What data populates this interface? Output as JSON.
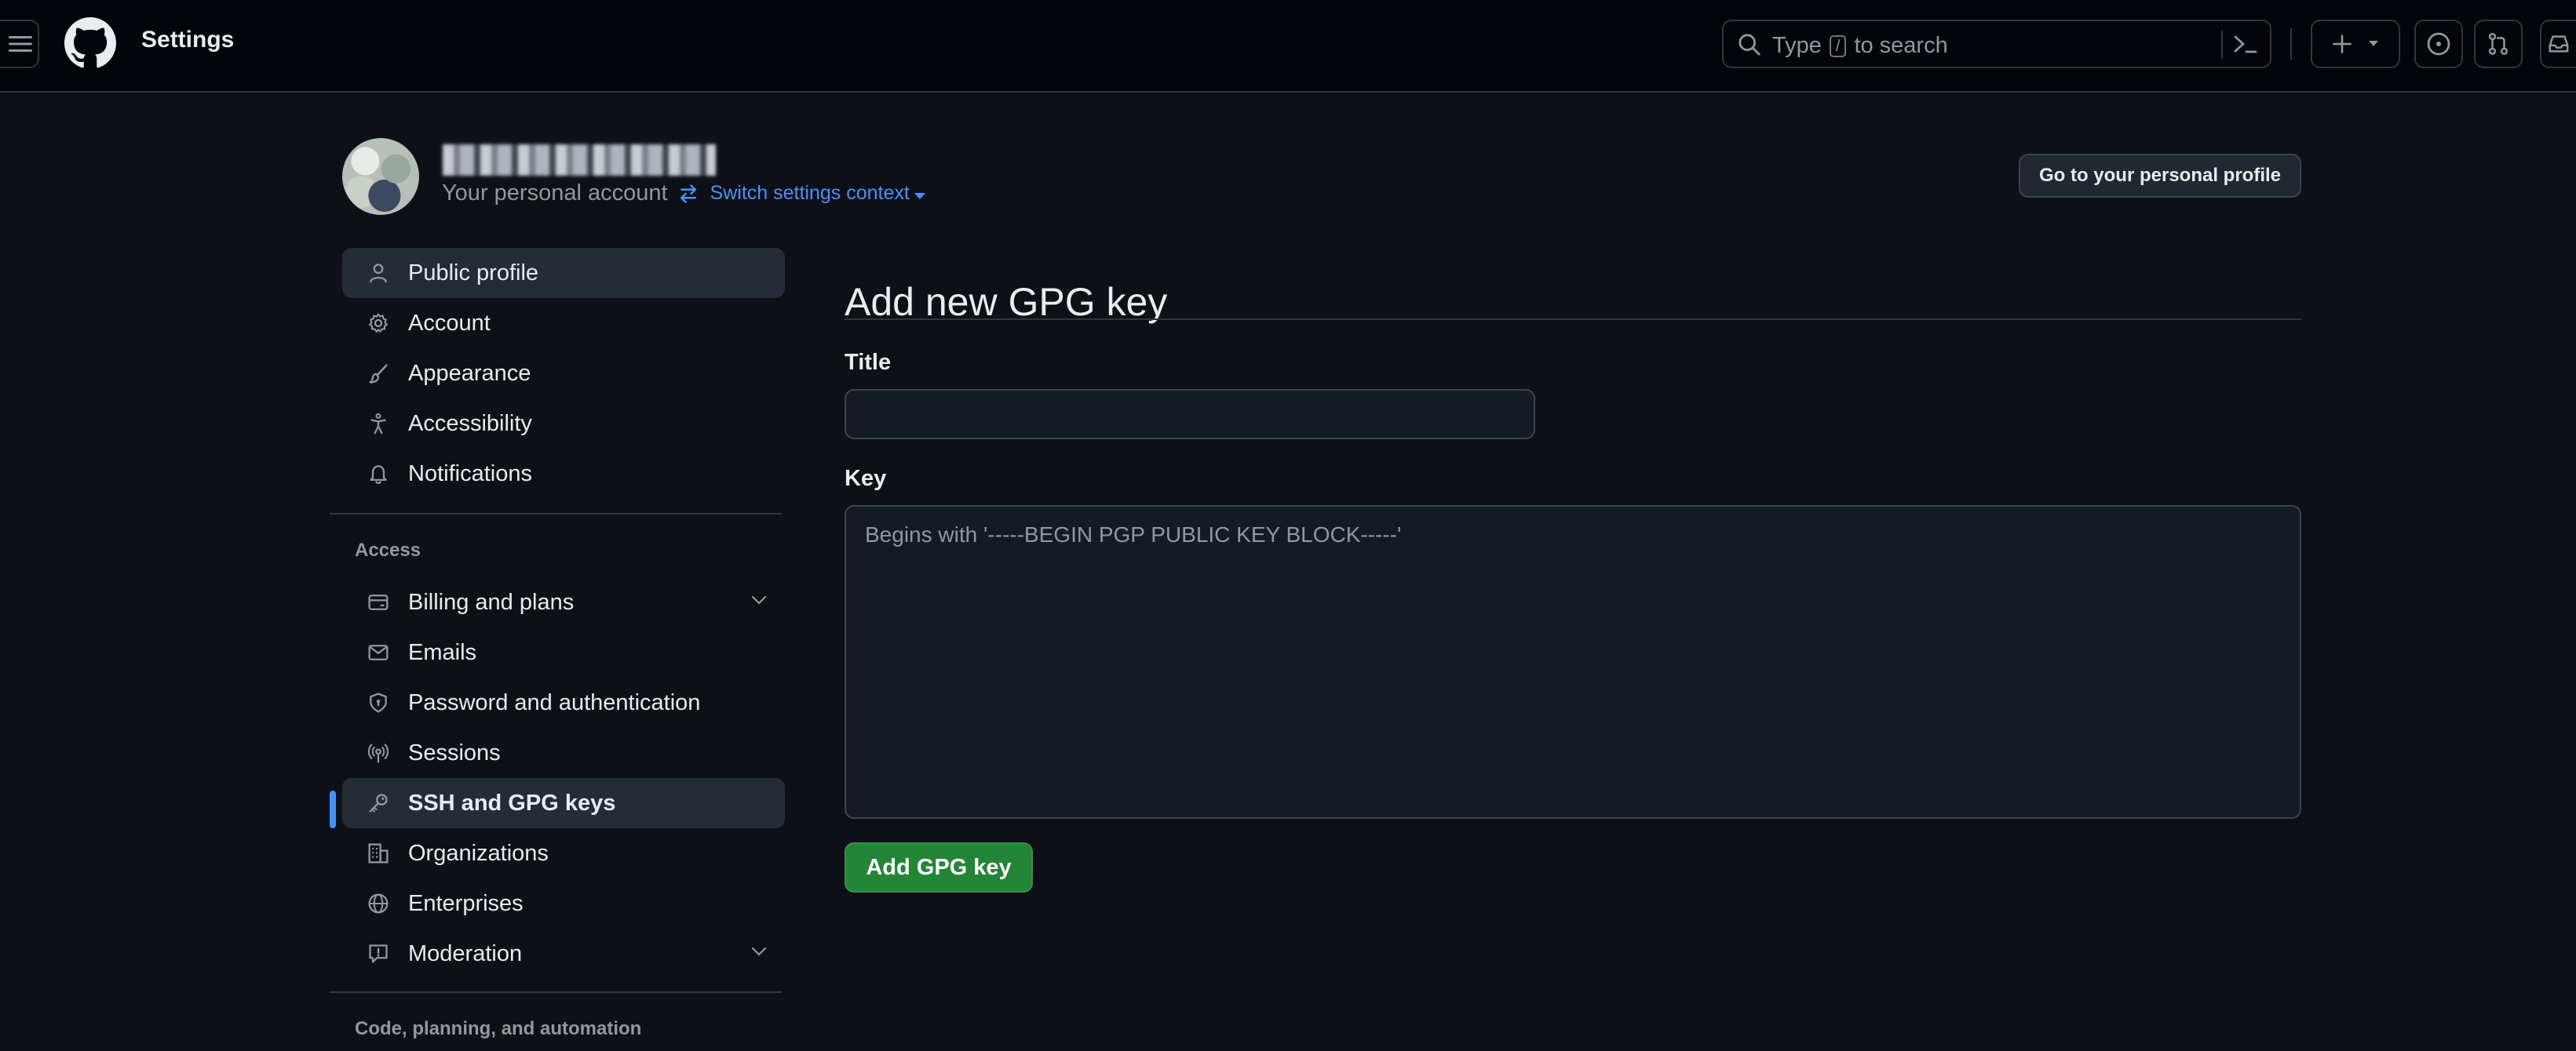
{
  "header": {
    "title": "Settings",
    "search": {
      "prefix": "Type",
      "key": "/",
      "suffix": "to search"
    }
  },
  "context": {
    "account_type": "Your personal account",
    "switch_label": "Switch settings context",
    "profile_button": "Go to your personal profile"
  },
  "sidebar": {
    "items": [
      {
        "label": "Public profile",
        "icon": "person-icon"
      },
      {
        "label": "Account",
        "icon": "gear-icon"
      },
      {
        "label": "Appearance",
        "icon": "paintbrush-icon"
      },
      {
        "label": "Accessibility",
        "icon": "accessibility-icon"
      },
      {
        "label": "Notifications",
        "icon": "bell-icon"
      }
    ],
    "access_heading": "Access",
    "access_items": [
      {
        "label": "Billing and plans",
        "icon": "credit-card-icon",
        "expandable": true
      },
      {
        "label": "Emails",
        "icon": "mail-icon"
      },
      {
        "label": "Password and authentication",
        "icon": "shield-lock-icon"
      },
      {
        "label": "Sessions",
        "icon": "broadcast-icon"
      },
      {
        "label": "SSH and GPG keys",
        "icon": "key-icon",
        "selected": true
      },
      {
        "label": "Organizations",
        "icon": "organization-icon"
      },
      {
        "label": "Enterprises",
        "icon": "globe-icon"
      },
      {
        "label": "Moderation",
        "icon": "report-icon",
        "expandable": true
      }
    ],
    "code_heading": "Code, planning, and automation"
  },
  "main": {
    "title": "Add new GPG key",
    "title_label": "Title",
    "title_value": "",
    "key_label": "Key",
    "key_placeholder": "Begins with '-----BEGIN PGP PUBLIC KEY BLOCK-----'",
    "submit_label": "Add GPG key"
  },
  "colors": {
    "background": "#0d1117",
    "header_bg": "#010409",
    "accent_blue": "#4493f8",
    "primary_green": "#238636"
  }
}
